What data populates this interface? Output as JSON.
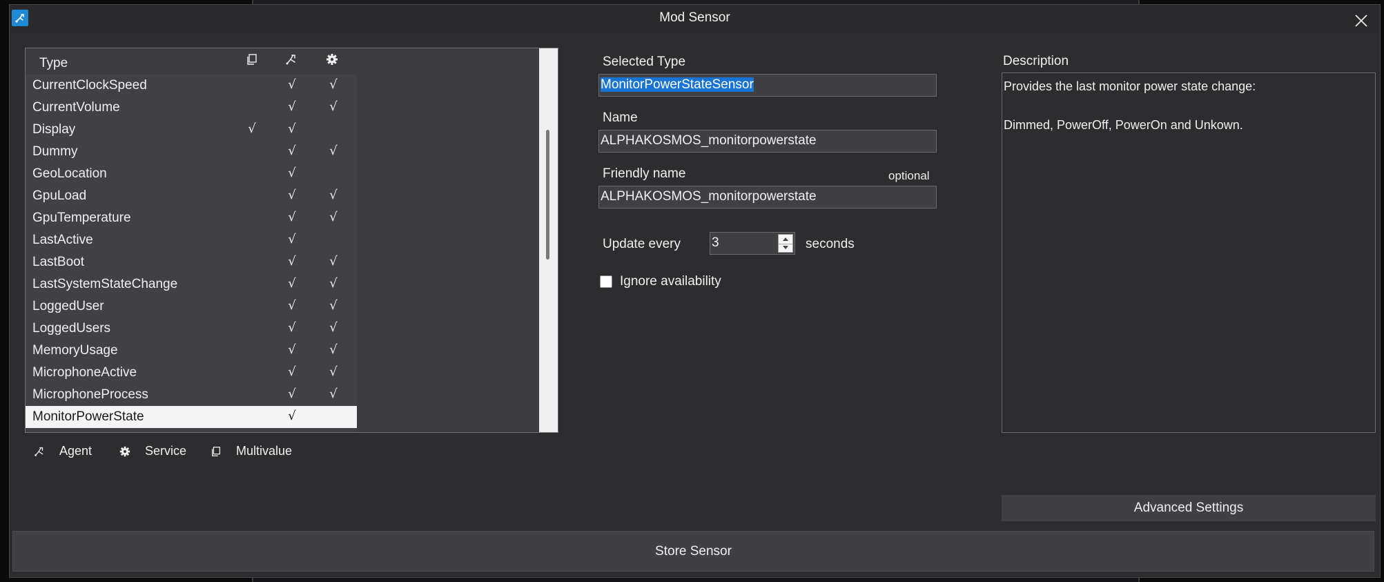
{
  "window": {
    "title": "Mod Sensor",
    "icon": "hass-agent-icon",
    "accent": "#1e8ad6"
  },
  "type_list": {
    "header": {
      "type_label": "Type",
      "multivalue_icon": "multivalue-icon",
      "agent_icon": "agent-icon",
      "service_icon": "gear-icon"
    },
    "check_mark": "√",
    "rows": [
      {
        "name": "CurrentClockSpeed",
        "multivalue": "",
        "agent": "√",
        "service": "√"
      },
      {
        "name": "CurrentVolume",
        "multivalue": "",
        "agent": "√",
        "service": "√"
      },
      {
        "name": "Display",
        "multivalue": "√",
        "agent": "√",
        "service": ""
      },
      {
        "name": "Dummy",
        "multivalue": "",
        "agent": "√",
        "service": "√"
      },
      {
        "name": "GeoLocation",
        "multivalue": "",
        "agent": "√",
        "service": ""
      },
      {
        "name": "GpuLoad",
        "multivalue": "",
        "agent": "√",
        "service": "√"
      },
      {
        "name": "GpuTemperature",
        "multivalue": "",
        "agent": "√",
        "service": "√"
      },
      {
        "name": "LastActive",
        "multivalue": "",
        "agent": "√",
        "service": ""
      },
      {
        "name": "LastBoot",
        "multivalue": "",
        "agent": "√",
        "service": "√"
      },
      {
        "name": "LastSystemStateChange",
        "multivalue": "",
        "agent": "√",
        "service": "√"
      },
      {
        "name": "LoggedUser",
        "multivalue": "",
        "agent": "√",
        "service": "√"
      },
      {
        "name": "LoggedUsers",
        "multivalue": "",
        "agent": "√",
        "service": "√"
      },
      {
        "name": "MemoryUsage",
        "multivalue": "",
        "agent": "√",
        "service": "√"
      },
      {
        "name": "MicrophoneActive",
        "multivalue": "",
        "agent": "√",
        "service": "√"
      },
      {
        "name": "MicrophoneProcess",
        "multivalue": "",
        "agent": "√",
        "service": "√"
      },
      {
        "name": "MonitorPowerState",
        "multivalue": "",
        "agent": "√",
        "service": "",
        "selected": true
      }
    ]
  },
  "legend": {
    "agent": "Agent",
    "service": "Service",
    "multivalue": "Multivalue"
  },
  "form": {
    "selected_type_label": "Selected Type",
    "selected_type_value": "MonitorPowerStateSensor",
    "name_label": "Name",
    "name_value": "ALPHAKOSMOS_monitorpowerstate",
    "friendly_name_label": "Friendly name",
    "friendly_name_hint": "optional",
    "friendly_name_value": "ALPHAKOSMOS_monitorpowerstate",
    "update_label": "Update every",
    "update_value": "3",
    "update_unit": "seconds",
    "ignore_availability_label": "Ignore availability",
    "ignore_availability_checked": false
  },
  "description": {
    "label": "Description",
    "line1": "Provides the last monitor power state change:",
    "line2": "Dimmed, PowerOff, PowerOn and Unkown."
  },
  "buttons": {
    "advanced_settings": "Advanced Settings",
    "store_sensor": "Store Sensor"
  }
}
